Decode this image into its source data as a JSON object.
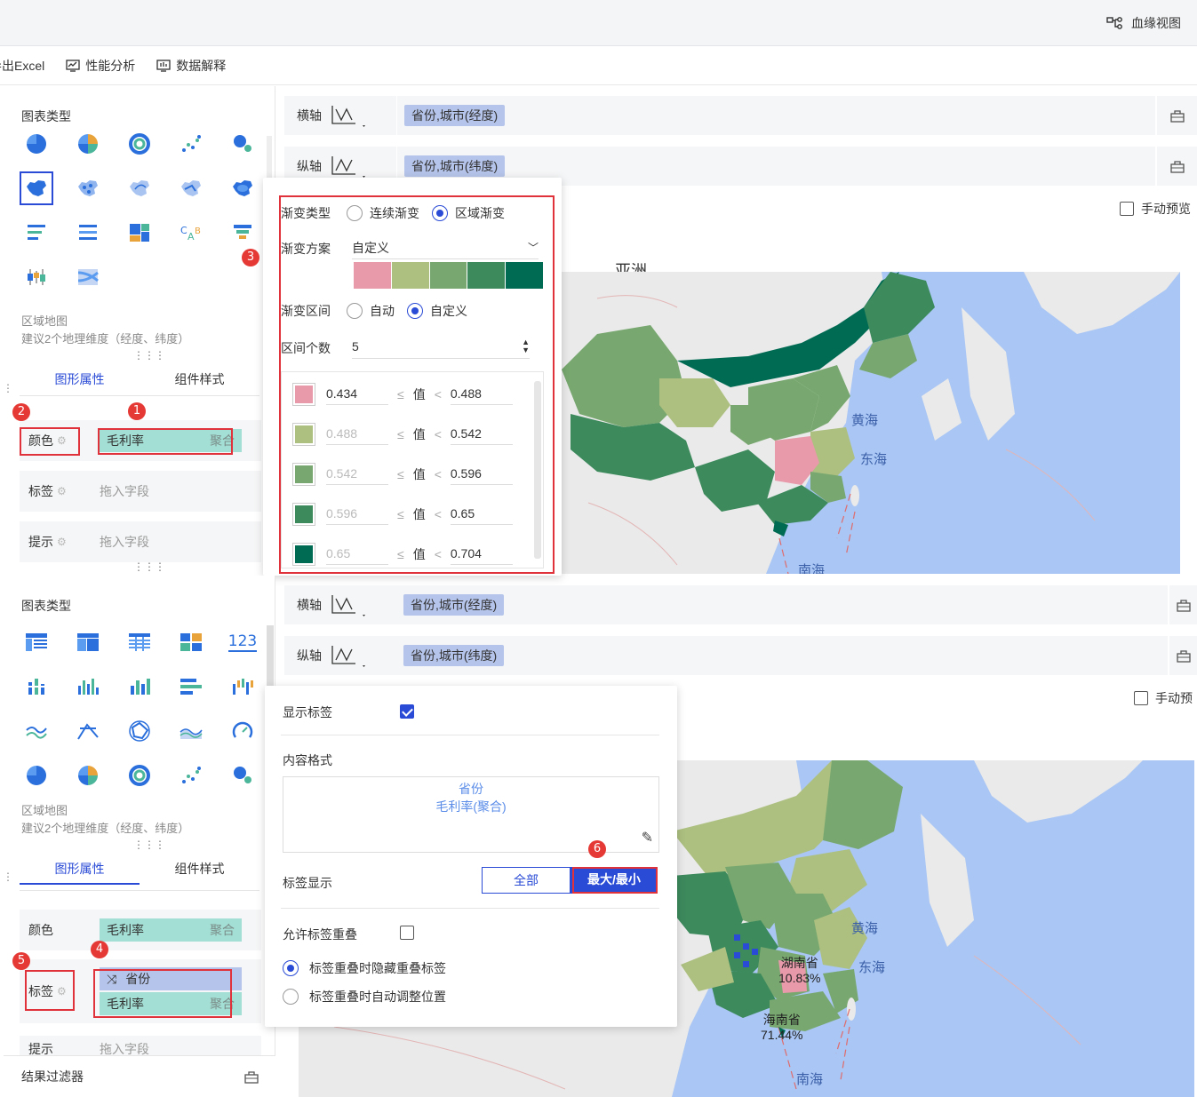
{
  "topbar": {
    "lineage_label": "血缘视图"
  },
  "toolbar": {
    "export_label": "导出Excel",
    "perf_label": "性能分析",
    "explain_label": "数据解释"
  },
  "panel1": {
    "chart_type_title": "图表类型",
    "hint_title": "区域地图",
    "hint_desc": "建议2个地理维度（经度、纬度）",
    "tab_graphic": "图形属性",
    "tab_component": "组件样式",
    "color_label": "颜色",
    "color_field": "毛利率",
    "color_agg": "聚合",
    "label_label": "标签",
    "label_placeholder": "拖入字段",
    "tip_label": "提示",
    "tip_placeholder": "拖入字段"
  },
  "axes1": {
    "x_label": "横轴",
    "x_field": "省份,城市(经度)",
    "y_label": "纵轴",
    "y_field": "省份,城市(纬度)",
    "manual_preview": "手动预览"
  },
  "gradient_popup": {
    "type_label": "渐变类型",
    "type_continuous": "连续渐变",
    "type_region": "区域渐变",
    "scheme_label": "渐变方案",
    "scheme_value": "自定义",
    "scheme_colors": [
      "#e899aa",
      "#adc080",
      "#78a86f",
      "#3d8a5d",
      "#006b53"
    ],
    "interval_label": "渐变区间",
    "interval_auto": "自动",
    "interval_custom": "自定义",
    "count_label": "区间个数",
    "count_value": "5",
    "value_word": "值",
    "ranges": [
      {
        "color": "#e899aa",
        "min": "0.434",
        "max": "0.488"
      },
      {
        "color": "#adc080",
        "min": "0.488",
        "max": "0.542"
      },
      {
        "color": "#78a86f",
        "min": "0.542",
        "max": "0.596"
      },
      {
        "color": "#3d8a5d",
        "min": "0.596",
        "max": "0.65"
      },
      {
        "color": "#006b53",
        "min": "0.65",
        "max": "0.704"
      }
    ]
  },
  "map1": {
    "huanghai": "黄海",
    "donghai": "东海",
    "nanhai": "南海",
    "top_text": "亚洲"
  },
  "panel2": {
    "chart_type_title": "图表类型",
    "hint_title": "区域地图",
    "hint_desc": "建议2个地理维度（经度、纬度）",
    "tab_graphic": "图形属性",
    "tab_component": "组件样式",
    "color_label": "颜色",
    "color_field": "毛利率",
    "color_agg": "聚合",
    "label_label": "标签",
    "label_field1": "省份",
    "label_field2": "毛利率",
    "label_field2_agg": "聚合",
    "tip_label": "提示",
    "tip_placeholder": "拖入字段",
    "result_filter": "结果过滤器",
    "num_icon_text": "123"
  },
  "axes2": {
    "x_label": "横轴",
    "x_field": "省份,城市(经度)",
    "y_label": "纵轴",
    "y_field": "省份,城市(纬度)",
    "manual_preview": "手动预"
  },
  "label_popup": {
    "show_label": "显示标签",
    "content_format": "内容格式",
    "content_line1": "省份",
    "content_line2": "毛利率(聚合)",
    "label_display": "标签显示",
    "opt_all": "全部",
    "opt_maxmin": "最大/最小",
    "allow_overlap": "允许标签重叠",
    "radio_hide": "标签重叠时隐藏重叠标签",
    "radio_adjust": "标签重叠时自动调整位置"
  },
  "map2": {
    "huanghai": "黄海",
    "donghai": "东海",
    "nanhai": "南海",
    "hunan_name": "湖南省",
    "hunan_value": "10.83%",
    "hainan_name": "海南省",
    "hainan_value": "71.44%"
  },
  "badges": [
    "1",
    "2",
    "3",
    "4",
    "5",
    "6"
  ]
}
